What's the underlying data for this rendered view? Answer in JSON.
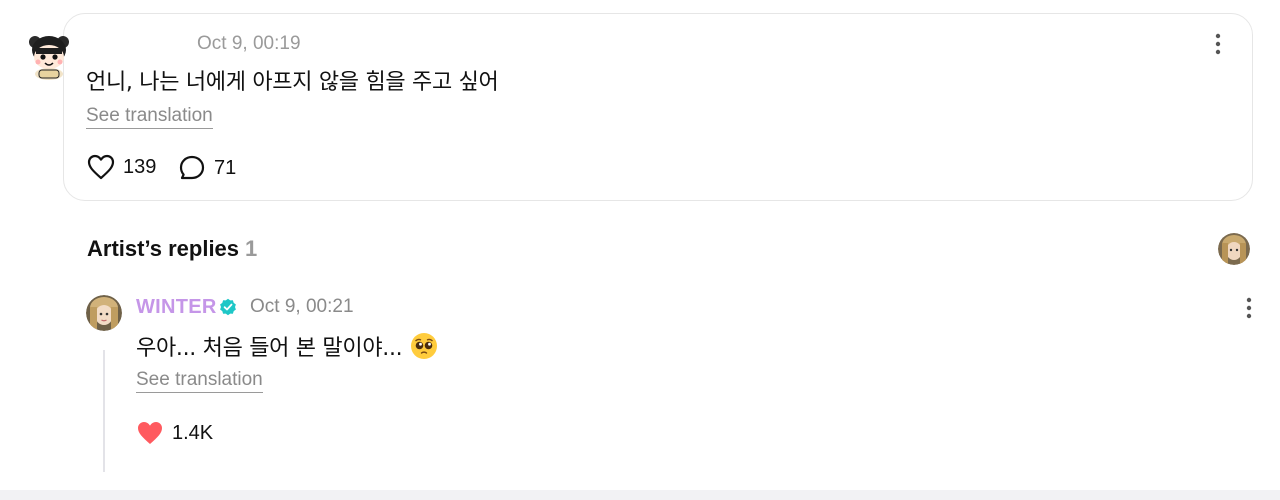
{
  "post": {
    "time": "Oct 9, 00:19",
    "text": "언니, 나는 너에게 아프지 않을 힘을 주고 싶어",
    "see_translation": "See translation",
    "likes": "139",
    "comments": "71",
    "like_icon": "heart-outline-icon",
    "comment_icon": "comment-bubble-icon"
  },
  "artist_replies": {
    "title": "Artist’s replies",
    "count": "1"
  },
  "reply": {
    "author": "WINTER",
    "time": "Oct 9, 00:21",
    "text": "우아... 처음 들어 본 말이야...",
    "emoji": "pleading-face-emoji",
    "see_translation": "See translation",
    "likes": "1.4K",
    "name_color": "#c596e8",
    "verified_color": "#1ec7c7",
    "like_color": "#ff5a5f"
  }
}
